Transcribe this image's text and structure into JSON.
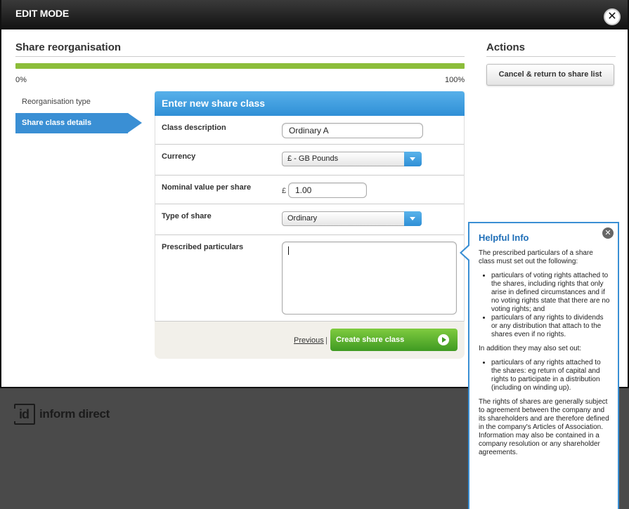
{
  "modal": {
    "title": "EDIT MODE",
    "close_label": "✕"
  },
  "header": {
    "title": "Share reorganisation"
  },
  "progress": {
    "value_percent": 100,
    "min_label": "0%",
    "max_label": "100%",
    "color": "#8cbd3a"
  },
  "steps": [
    {
      "label": "Reorganisation type",
      "active": false
    },
    {
      "label": "Share class details",
      "active": true
    }
  ],
  "form": {
    "title": "Enter new share class",
    "class_description": {
      "label": "Class description",
      "value": "Ordinary A"
    },
    "currency": {
      "label": "Currency",
      "value": "£ - GB Pounds"
    },
    "nominal_value": {
      "label": "Nominal value per share",
      "prefix": "£",
      "value": "1.00"
    },
    "type_of_share": {
      "label": "Type of share",
      "value": "Ordinary"
    },
    "prescribed_particulars": {
      "label": "Prescribed particulars",
      "value": ""
    },
    "previous_label": "Previous",
    "separator": "|",
    "create_label": "Create share class"
  },
  "actions": {
    "title": "Actions",
    "cancel_label": "Cancel & return to share list"
  },
  "logo": {
    "mark": "id",
    "text": "inform direct"
  },
  "help": {
    "title": "Helpful Info",
    "close_label": "✕",
    "intro": "The prescribed particulars of a share class must set out the following:",
    "list1": [
      "particulars of voting rights attached to the shares, including rights that only arise in defined circumstances and if no voting rights state that there are no voting rights; and",
      "particulars of any rights to dividends or any distribution that attach to the shares even if no rights."
    ],
    "mid": "In addition they may also set out:",
    "list2": [
      "particulars of any rights attached to the shares: eg return of capital and rights to participate in a distribution (including on winding up)."
    ],
    "outro": "The rights of shares are generally subject to agreement between the company and its shareholders and are therefore defined in the company's Articles of Association. Information may also be contained in a company resolution or any shareholder agreements."
  },
  "colors": {
    "accent": "#3a8fd4",
    "success": "#3f9a22",
    "header_bg": "#111111"
  }
}
